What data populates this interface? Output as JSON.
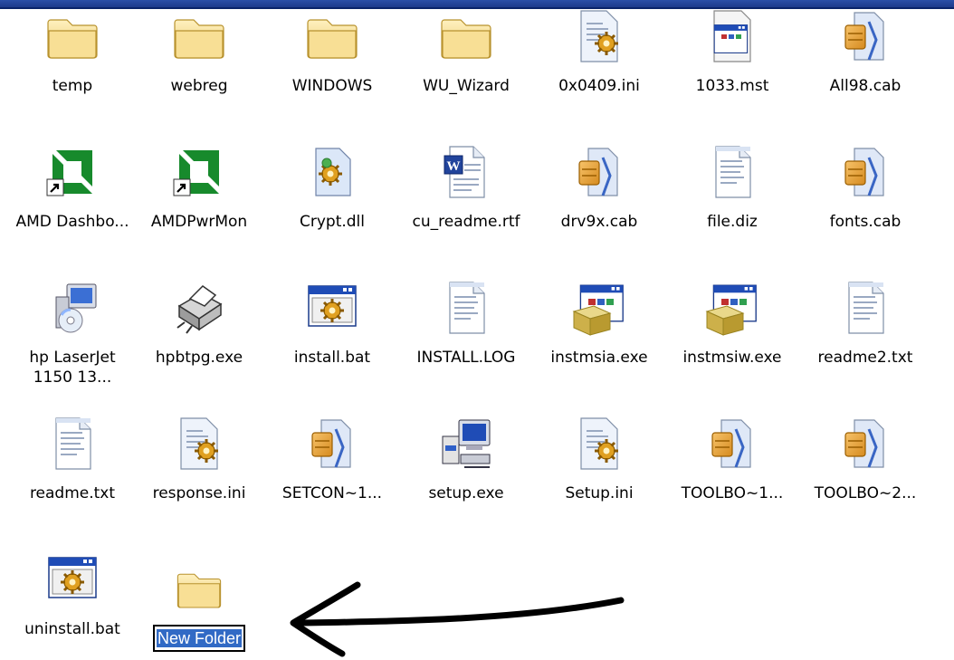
{
  "files": [
    {
      "label": "temp",
      "icon": "folder-icon"
    },
    {
      "label": "webreg",
      "icon": "folder-icon"
    },
    {
      "label": "WINDOWS",
      "icon": "folder-icon"
    },
    {
      "label": "WU_Wizard",
      "icon": "folder-icon"
    },
    {
      "label": "0x0409.ini",
      "icon": "config-file-icon"
    },
    {
      "label": "1033.mst",
      "icon": "mst-file-icon"
    },
    {
      "label": "All98.cab",
      "icon": "cabinet-file-icon"
    },
    {
      "label": "AMD Dashbo...",
      "icon": "amd-shortcut-icon"
    },
    {
      "label": "AMDPwrMon",
      "icon": "amd-shortcut-icon"
    },
    {
      "label": "Crypt.dll",
      "icon": "dll-file-icon"
    },
    {
      "label": "cu_readme.rtf",
      "icon": "word-document-icon"
    },
    {
      "label": "drv9x.cab",
      "icon": "cabinet-file-icon"
    },
    {
      "label": "file.diz",
      "icon": "text-file-icon"
    },
    {
      "label": "fonts.cab",
      "icon": "cabinet-file-icon"
    },
    {
      "label": "hp LaserJet 1150  13...",
      "icon": "installer-cd-icon"
    },
    {
      "label": "hpbtpg.exe",
      "icon": "printer-exe-icon"
    },
    {
      "label": "install.bat",
      "icon": "batch-file-icon"
    },
    {
      "label": "INSTALL.LOG",
      "icon": "text-file-icon"
    },
    {
      "label": "instmsia.exe",
      "icon": "msi-installer-icon"
    },
    {
      "label": "instmsiw.exe",
      "icon": "msi-installer-icon"
    },
    {
      "label": "readme2.txt",
      "icon": "text-file-icon"
    },
    {
      "label": "readme.txt",
      "icon": "text-file-icon"
    },
    {
      "label": "response.ini",
      "icon": "config-file-icon"
    },
    {
      "label": "SETCON~1...",
      "icon": "cabinet-file-icon"
    },
    {
      "label": "setup.exe",
      "icon": "setup-computer-icon"
    },
    {
      "label": "Setup.ini",
      "icon": "config-file-icon"
    },
    {
      "label": "TOOLBO~1...",
      "icon": "cabinet-file-icon"
    },
    {
      "label": "TOOLBO~2...",
      "icon": "cabinet-file-icon"
    },
    {
      "label": "uninstall.bat",
      "icon": "batch-file-icon"
    }
  ],
  "new_folder": {
    "label": "New Folder",
    "icon": "folder-icon",
    "state": "renaming"
  },
  "annotation": {
    "icon": "hand-drawn-arrow-icon"
  },
  "colors": {
    "title_bar": "#1d3a8a",
    "selection": "#316ac5",
    "folder": "#f3d98a"
  }
}
